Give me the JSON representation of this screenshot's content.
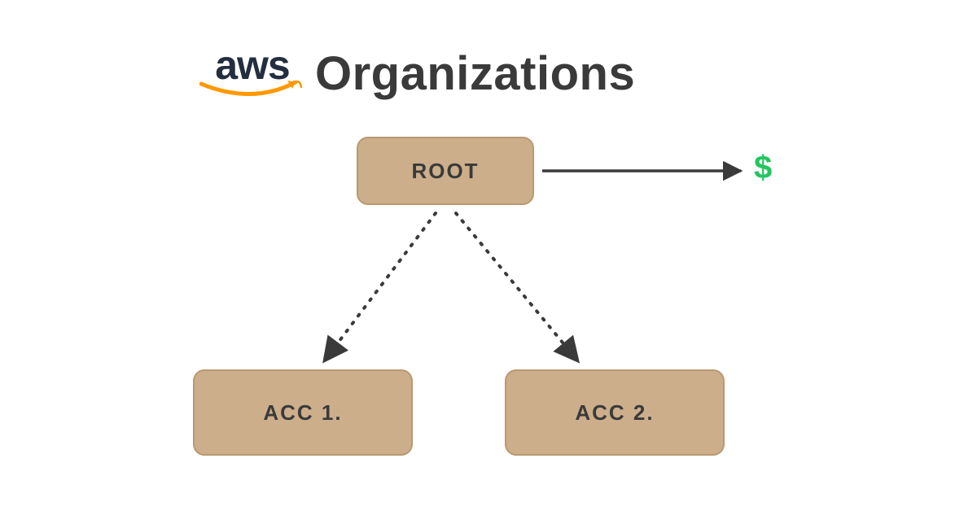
{
  "title": {
    "logo_text": "aws",
    "heading": "Organizations"
  },
  "nodes": {
    "root": "ROOT",
    "acc1": "ACC 1.",
    "acc2": "ACC 2."
  },
  "symbols": {
    "dollar": "$"
  },
  "colors": {
    "node_fill": "#cdae8b",
    "node_border": "#b99972",
    "text_dark": "#3a3a3a",
    "aws_navy": "#232F3E",
    "aws_orange": "#FF9900",
    "dollar_green": "#22c55e"
  },
  "diagram": {
    "type": "tree",
    "description": "AWS Organizations hierarchy showing a ROOT account with consolidated billing ($), branching to two member accounts ACC 1. and ACC 2.",
    "edges": [
      {
        "from": "root",
        "to": "dollar",
        "style": "solid"
      },
      {
        "from": "root",
        "to": "acc1",
        "style": "dotted"
      },
      {
        "from": "root",
        "to": "acc2",
        "style": "dotted"
      }
    ]
  }
}
